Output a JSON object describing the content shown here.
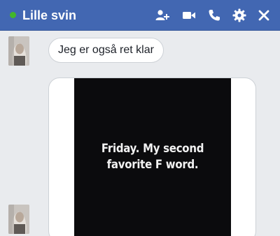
{
  "header": {
    "title": "Lille svin",
    "status": "online",
    "colors": {
      "background": "#4267b2",
      "status_dot": "#42b72a"
    },
    "icons": [
      "add-people-icon",
      "video-call-icon",
      "phone-call-icon",
      "gear-icon",
      "close-icon"
    ]
  },
  "messages": [
    {
      "type": "text",
      "text": "Jeg er også ret klar",
      "sender_avatar": "avatar"
    },
    {
      "type": "image",
      "image_text": "Friday. My second favorite F word.",
      "sender_avatar": "avatar"
    }
  ]
}
